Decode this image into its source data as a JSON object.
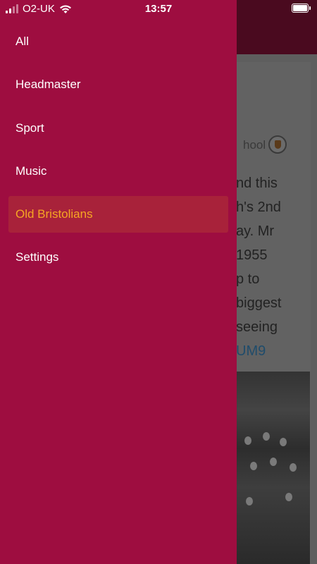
{
  "status_bar": {
    "carrier": "O2-UK",
    "time": "13:57"
  },
  "drawer": {
    "items": [
      {
        "label": "All",
        "active": false
      },
      {
        "label": "Headmaster",
        "active": false
      },
      {
        "label": "Sport",
        "active": false
      },
      {
        "label": "Music",
        "active": false
      },
      {
        "label": "Old Bristolians",
        "active": true
      },
      {
        "label": "Settings",
        "active": false
      }
    ]
  },
  "background_content": {
    "handle_fragment": "hool",
    "tweet_fragments": [
      "nd this",
      "h's 2nd",
      "ay. Mr",
      "1955",
      "p to",
      "biggest",
      "seeing"
    ],
    "link_fragment": "UM9"
  },
  "colors": {
    "drawer_bg": "#9e0d40",
    "active_item_bg": "#a8223a",
    "active_item_text": "#f6a623",
    "header_bg": "#4a0a1f"
  }
}
